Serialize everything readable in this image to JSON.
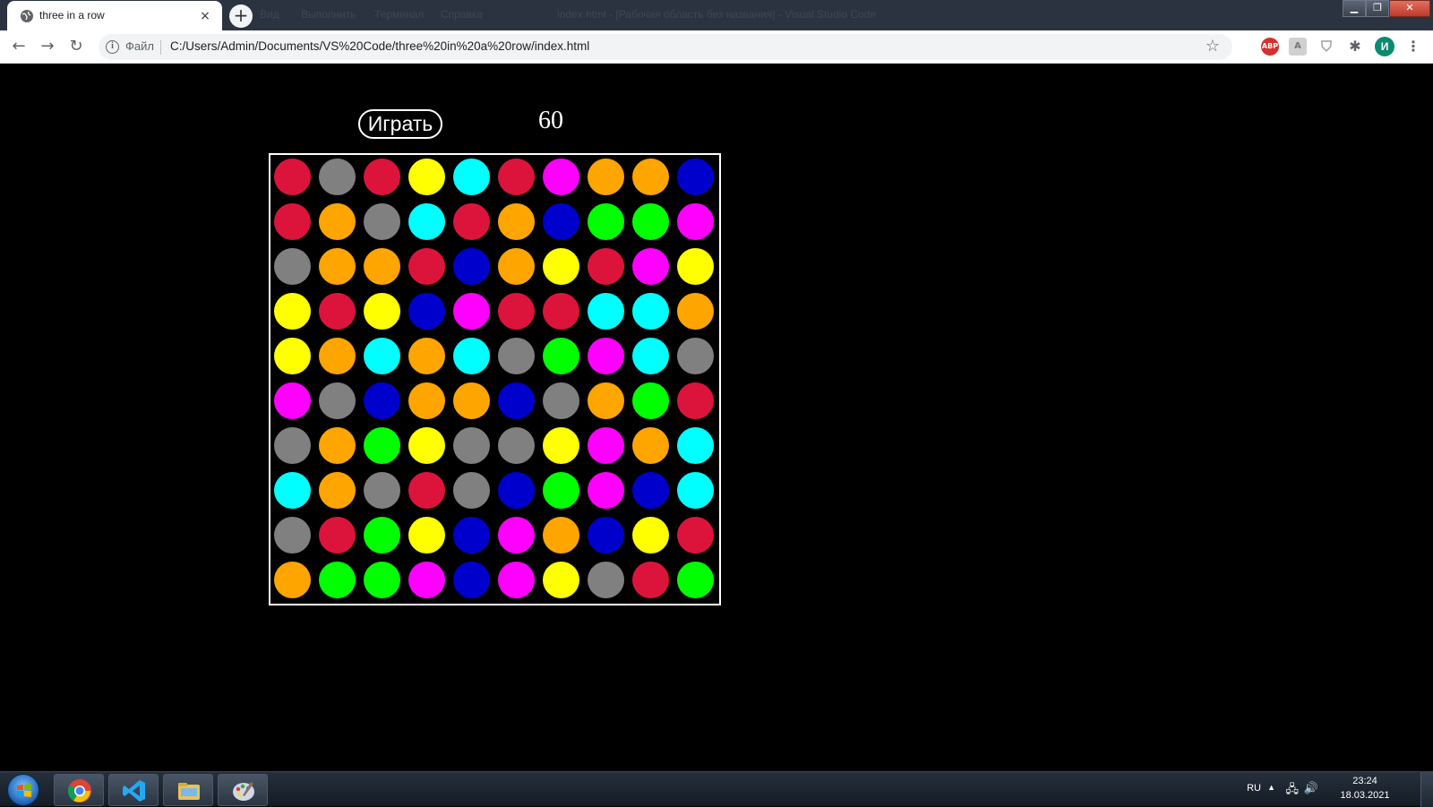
{
  "browser": {
    "tab_title": "three in a row",
    "tab_close": "×",
    "new_tab": "+",
    "ghost_menu": [
      "Вид",
      "Выполнить",
      "Терминал",
      "Справка"
    ],
    "ghost_title": "index.html - [Рабочая область без названия] - Visual Studio Code",
    "window_buttons": {
      "minimize": "▁",
      "restore": "❐",
      "close": "✕"
    },
    "nav": {
      "back": "←",
      "forward": "→",
      "reload": "↻"
    },
    "scheme_label": "Файл",
    "url": "C:/Users/Admin/Documents/VS%20Code/three%20in%20a%20row/index.html",
    "extensions": {
      "adblock": "ABP",
      "pdf": "A",
      "shield": "⛉",
      "puzzle": "✱",
      "profile": "И",
      "menu": "⋮"
    }
  },
  "game": {
    "play_label": "Играть",
    "score": "60",
    "palette": {
      "R": "#dc143c",
      "G": "#808080",
      "Y": "#ffff00",
      "C": "#00ffff",
      "M": "#ff00ff",
      "O": "#ffa500",
      "B": "#0000cd",
      "L": "#00ff00"
    },
    "grid": [
      [
        "R",
        "G",
        "R",
        "Y",
        "C",
        "R",
        "M",
        "O",
        "O",
        "B"
      ],
      [
        "R",
        "O",
        "G",
        "C",
        "R",
        "O",
        "B",
        "L",
        "L",
        "M"
      ],
      [
        "G",
        "O",
        "O",
        "R",
        "B",
        "O",
        "Y",
        "R",
        "M",
        "Y"
      ],
      [
        "Y",
        "R",
        "Y",
        "B",
        "M",
        "R",
        "R",
        "C",
        "C",
        "O"
      ],
      [
        "Y",
        "O",
        "C",
        "O",
        "C",
        "G",
        "L",
        "M",
        "C",
        "G"
      ],
      [
        "M",
        "G",
        "B",
        "O",
        "O",
        "B",
        "G",
        "O",
        "L",
        "R"
      ],
      [
        "G",
        "O",
        "L",
        "Y",
        "G",
        "G",
        "Y",
        "M",
        "O",
        "C"
      ],
      [
        "C",
        "O",
        "G",
        "R",
        "G",
        "B",
        "L",
        "M",
        "B",
        "C"
      ],
      [
        "G",
        "R",
        "L",
        "Y",
        "B",
        "M",
        "O",
        "B",
        "Y",
        "R"
      ],
      [
        "O",
        "L",
        "L",
        "M",
        "B",
        "M",
        "Y",
        "G",
        "R",
        "L"
      ]
    ]
  },
  "taskbar": {
    "apps": [
      "chrome-icon",
      "vscode-icon",
      "explorer-icon",
      "paint-icon"
    ],
    "language": "RU",
    "tray_arrow": "▲",
    "network_icon": "🖧",
    "volume_icon": "🔊",
    "time": "23:24",
    "date": "18.03.2021"
  }
}
